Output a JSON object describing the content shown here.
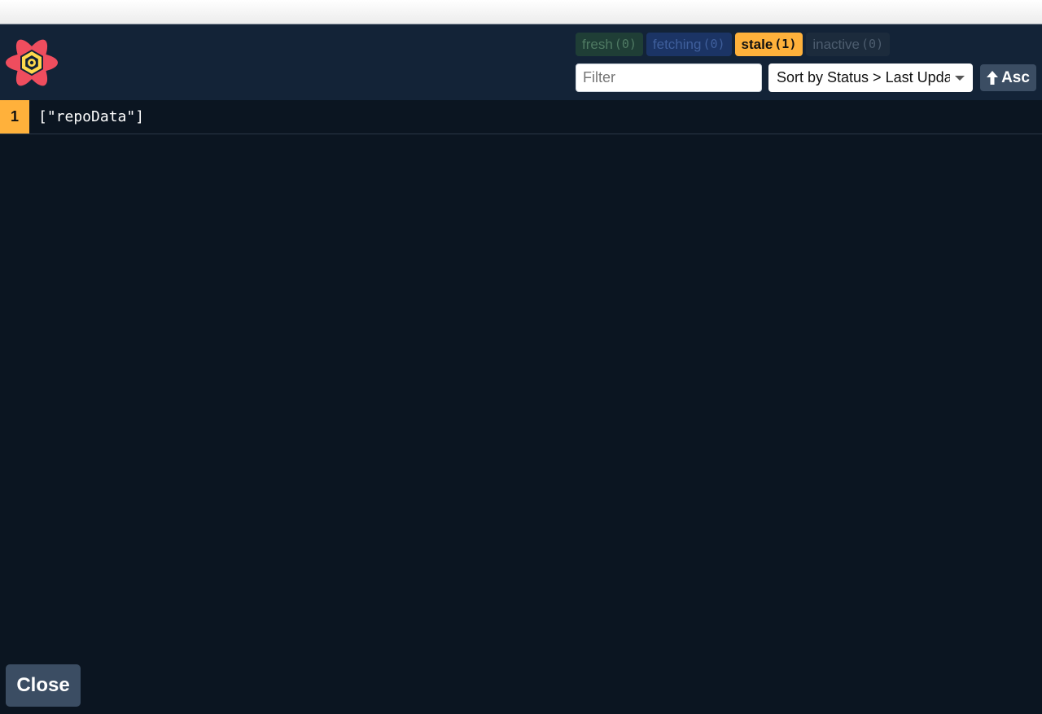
{
  "filters": {
    "fresh": {
      "label": "fresh",
      "count": "(0)"
    },
    "fetching": {
      "label": "fetching",
      "count": "(0)"
    },
    "stale": {
      "label": "stale",
      "count": "(1)"
    },
    "inactive": {
      "label": "inactive",
      "count": "(0)"
    }
  },
  "filter_input": {
    "placeholder": "Filter",
    "value": ""
  },
  "sort": {
    "selected": "Sort by Status > Last Updated"
  },
  "sort_direction": {
    "icon": "arrow-up-icon",
    "label": "Asc"
  },
  "queries": [
    {
      "observers": "1",
      "key": "[\"repoData\"]",
      "status": "stale"
    }
  ],
  "close_label": "Close",
  "colors": {
    "stale": "#ffb13b",
    "panel_bg": "#0b1521",
    "header_bg": "#132337",
    "button_bg": "#3b4d63"
  }
}
